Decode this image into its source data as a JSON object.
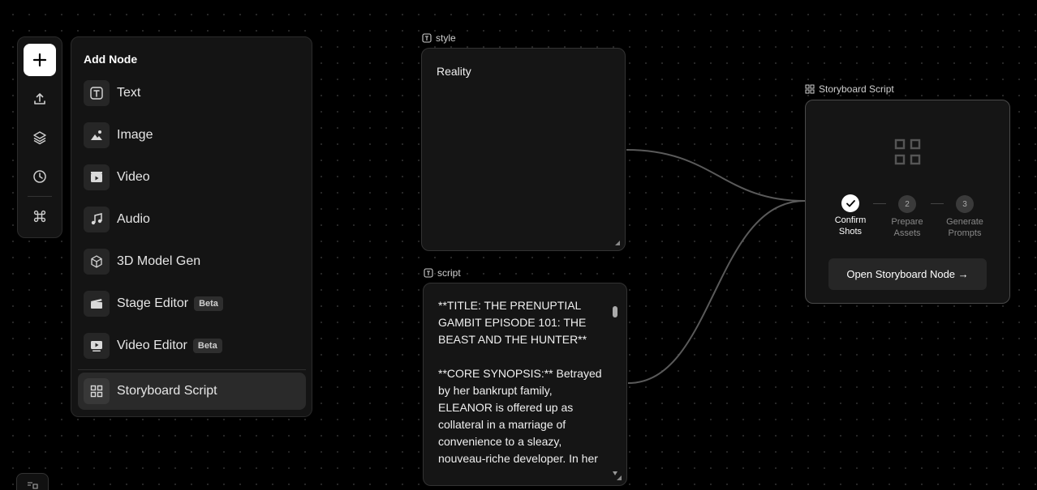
{
  "toolbar": {
    "items": [
      {
        "icon": "plus-icon"
      },
      {
        "icon": "upload-icon"
      },
      {
        "icon": "layers-icon"
      },
      {
        "icon": "history-icon"
      },
      {
        "icon": "command-icon"
      }
    ]
  },
  "add_node": {
    "title": "Add Node",
    "items": [
      {
        "label": "Text",
        "icon": "text-icon"
      },
      {
        "label": "Image",
        "icon": "image-icon"
      },
      {
        "label": "Video",
        "icon": "video-icon"
      },
      {
        "label": "Audio",
        "icon": "music-icon"
      },
      {
        "label": "3D Model Gen",
        "icon": "cube-icon"
      },
      {
        "label": "Stage Editor",
        "icon": "clapperboard-icon",
        "badge": "Beta"
      },
      {
        "label": "Video Editor",
        "icon": "video-editor-icon",
        "badge": "Beta"
      },
      {
        "label": "Storyboard Script",
        "icon": "grid-icon",
        "active": true
      }
    ]
  },
  "style_node": {
    "label": "style",
    "value": "Reality"
  },
  "script_node": {
    "label": "script",
    "line1": "**TITLE: THE PRENUPTIAL",
    "line2": "GAMBIT EPISODE 101: THE",
    "line3": "BEAST AND THE HUNTER**",
    "line4": "**CORE SYNOPSIS:** Betrayed",
    "line5": "by her bankrupt family,",
    "line6": "ELEANOR is offered up as",
    "line7": "collateral in a marriage of",
    "line8": "convenience to a sleazy,",
    "line9": "nouveau-riche developer. In her"
  },
  "storyboard_node": {
    "label": "Storyboard Script",
    "steps": [
      {
        "number": "1",
        "line1": "Confirm",
        "line2": "Shots",
        "state": "done"
      },
      {
        "number": "2",
        "line1": "Prepare",
        "line2": "Assets",
        "state": "todo"
      },
      {
        "number": "3",
        "line1": "Generate",
        "line2": "Prompts",
        "state": "todo"
      }
    ],
    "button_label": "Open Storyboard Node →"
  }
}
